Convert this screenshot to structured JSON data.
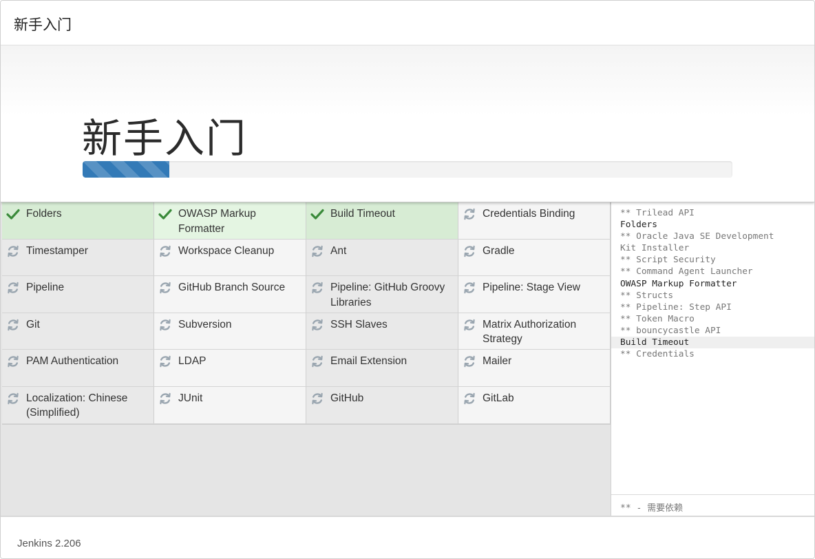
{
  "header": {
    "title": "新手入门"
  },
  "hero": {
    "title": "新手入门",
    "progress": 0.134
  },
  "plugins": [
    {
      "name": "Folders",
      "status": "success"
    },
    {
      "name": "OWASP Markup Formatter",
      "status": "success"
    },
    {
      "name": "Build Timeout",
      "status": "success"
    },
    {
      "name": "Credentials Binding",
      "status": "installing"
    },
    {
      "name": "Timestamper",
      "status": "pending"
    },
    {
      "name": "Workspace Cleanup",
      "status": "pending"
    },
    {
      "name": "Ant",
      "status": "pending"
    },
    {
      "name": "Gradle",
      "status": "pending"
    },
    {
      "name": "Pipeline",
      "status": "pending"
    },
    {
      "name": "GitHub Branch Source",
      "status": "pending"
    },
    {
      "name": "Pipeline: GitHub Groovy Libraries",
      "status": "pending"
    },
    {
      "name": "Pipeline: Stage View",
      "status": "pending"
    },
    {
      "name": "Git",
      "status": "pending"
    },
    {
      "name": "Subversion",
      "status": "pending"
    },
    {
      "name": "SSH Slaves",
      "status": "pending"
    },
    {
      "name": "Matrix Authorization Strategy",
      "status": "pending"
    },
    {
      "name": "PAM Authentication",
      "status": "pending"
    },
    {
      "name": "LDAP",
      "status": "pending"
    },
    {
      "name": "Email Extension",
      "status": "pending"
    },
    {
      "name": "Mailer",
      "status": "pending"
    },
    {
      "name": "Localization: Chinese (Simplified)",
      "status": "pending"
    },
    {
      "name": "JUnit",
      "status": "pending"
    },
    {
      "name": "GitHub",
      "status": "pending"
    },
    {
      "name": "GitLab",
      "status": "pending"
    }
  ],
  "log": {
    "lines": [
      {
        "text": "** Trilead API",
        "type": "dep"
      },
      {
        "text": "Folders",
        "type": "main"
      },
      {
        "text": "** Oracle Java SE Development",
        "type": "dep"
      },
      {
        "text": "Kit Installer",
        "type": "dep"
      },
      {
        "text": "** Script Security",
        "type": "dep"
      },
      {
        "text": "** Command Agent Launcher",
        "type": "dep"
      },
      {
        "text": "OWASP Markup Formatter",
        "type": "main"
      },
      {
        "text": "** Structs",
        "type": "dep"
      },
      {
        "text": "** Pipeline: Step API",
        "type": "dep"
      },
      {
        "text": "** Token Macro",
        "type": "dep"
      },
      {
        "text": "** bouncycastle API",
        "type": "dep"
      },
      {
        "text": "Build Timeout",
        "type": "main",
        "highlight": true
      },
      {
        "text": "** Credentials",
        "type": "dep"
      }
    ],
    "legend": "** - 需要依赖"
  },
  "footer": {
    "version": "Jenkins 2.206"
  },
  "colors": {
    "success": "#3a8a3a",
    "spinner": "#9aa6b0",
    "progress": "#337ab7"
  },
  "icons": {
    "success": "check-icon",
    "pending": "refresh-icon"
  }
}
